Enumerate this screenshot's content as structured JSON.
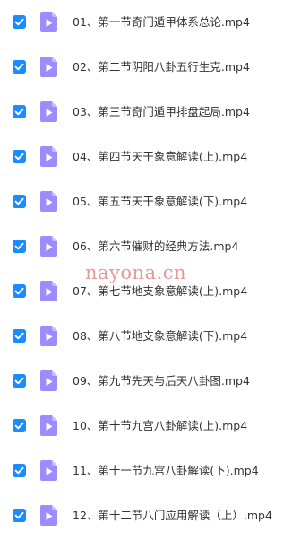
{
  "colors": {
    "checkbox": "#1a8cff",
    "video_icon": "#9d8cff",
    "video_icon_fold": "#c7bcff",
    "text": "#333333",
    "watermark": "#cd4646"
  },
  "watermark": "nayona.cn",
  "files": [
    {
      "name": "01、第一节奇门遁甲体系总论.mp4",
      "checked": true,
      "icon": "video-file-icon"
    },
    {
      "name": "02、第二节阴阳八卦五行生克.mp4",
      "checked": true,
      "icon": "video-file-icon"
    },
    {
      "name": "03、第三节奇门遁甲排盘起局.mp4",
      "checked": true,
      "icon": "video-file-icon"
    },
    {
      "name": "04、第四节天干象意解读(上).mp4",
      "checked": true,
      "icon": "video-file-icon"
    },
    {
      "name": "05、第五节天干象意解读(下).mp4",
      "checked": true,
      "icon": "video-file-icon"
    },
    {
      "name": "06、第六节催财的经典方法.mp4",
      "checked": true,
      "icon": "video-file-icon"
    },
    {
      "name": "07、第七节地支象意解读(上).mp4",
      "checked": true,
      "icon": "video-file-icon"
    },
    {
      "name": "08、第八节地支象意解读(下).mp4",
      "checked": true,
      "icon": "video-file-icon"
    },
    {
      "name": "09、第九节先天与后天八卦图.mp4",
      "checked": true,
      "icon": "video-file-icon"
    },
    {
      "name": "10、第十节九宫八卦解读(上).mp4",
      "checked": true,
      "icon": "video-file-icon"
    },
    {
      "name": "11、第十一节九宫八卦解读(下).mp4",
      "checked": true,
      "icon": "video-file-icon"
    },
    {
      "name": "12、第十二节八门应用解读（上）.mp4",
      "checked": true,
      "icon": "video-file-icon"
    }
  ]
}
